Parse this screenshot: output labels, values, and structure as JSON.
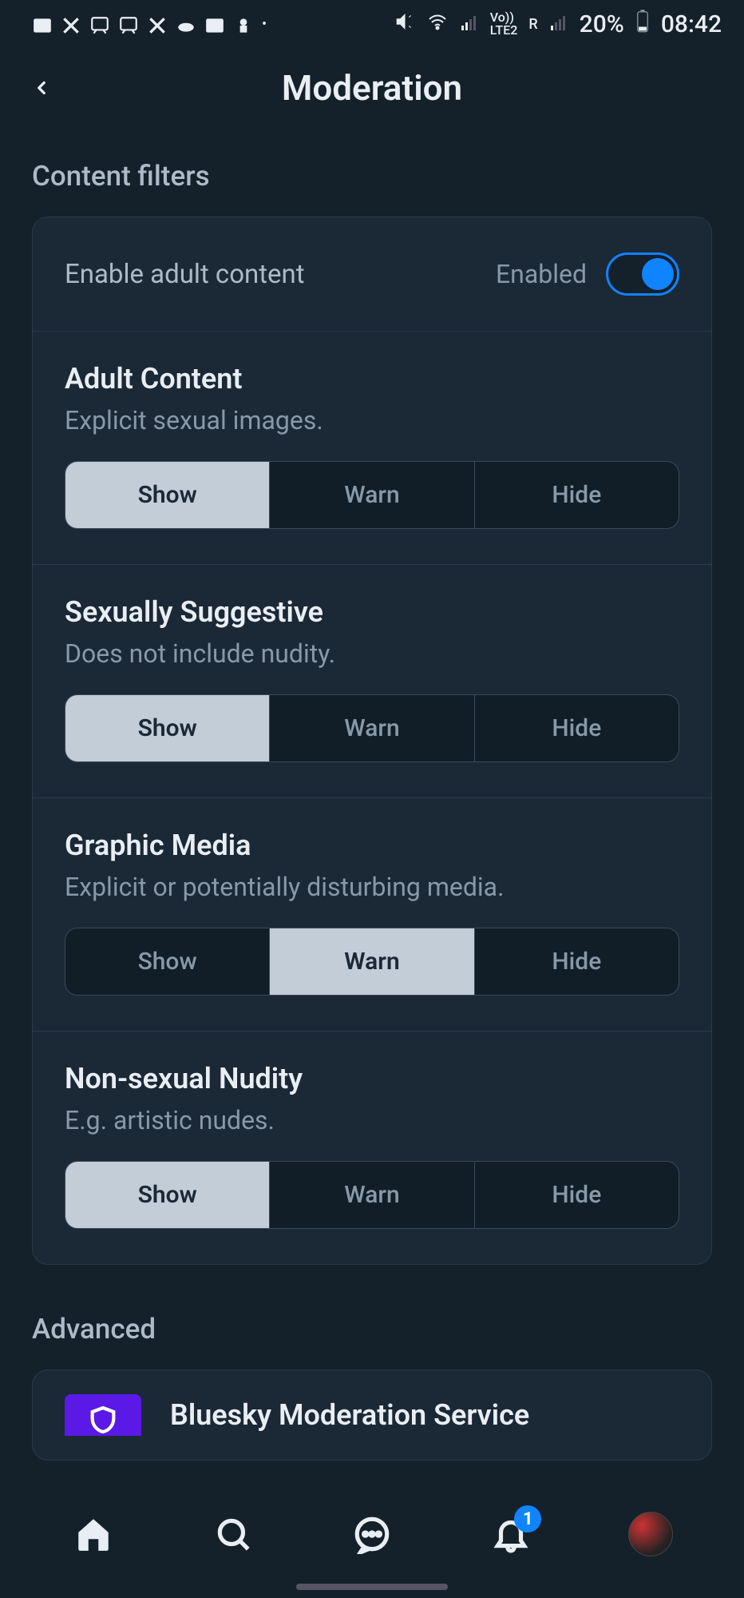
{
  "status_bar": {
    "battery_pct": "20%",
    "time": "08:42",
    "network": "LTE2",
    "roaming": "R",
    "volte": "Vo))"
  },
  "header": {
    "title": "Moderation"
  },
  "section_content_filters": "Content filters",
  "enable_row": {
    "label": "Enable adult content",
    "status": "Enabled",
    "enabled": true
  },
  "option_labels": {
    "show": "Show",
    "warn": "Warn",
    "hide": "Hide"
  },
  "filters": [
    {
      "title": "Adult Content",
      "desc": "Explicit sexual images.",
      "selected": "show"
    },
    {
      "title": "Sexually Suggestive",
      "desc": "Does not include nudity.",
      "selected": "show"
    },
    {
      "title": "Graphic Media",
      "desc": "Explicit or potentially disturbing media.",
      "selected": "warn"
    },
    {
      "title": "Non-sexual Nudity",
      "desc": "E.g. artistic nudes.",
      "selected": "show"
    }
  ],
  "section_advanced": "Advanced",
  "advanced_item": {
    "title": "Bluesky Moderation Service"
  },
  "bottom_nav": {
    "notification_badge": "1"
  },
  "colors": {
    "bg": "#14202a",
    "card": "#1b2836",
    "accent": "#1083fe",
    "seg_active_bg": "#c2cdd8"
  }
}
